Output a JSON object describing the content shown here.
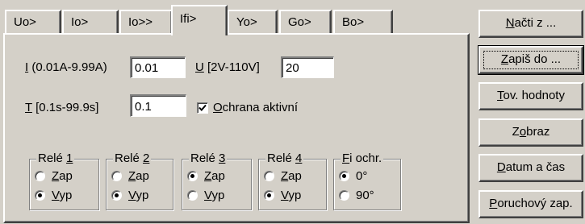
{
  "tabs": [
    {
      "label": "Uo>",
      "active": false
    },
    {
      "label": "Io>",
      "active": false
    },
    {
      "label": "Io>>",
      "active": false
    },
    {
      "label": "Ifi>",
      "active": true
    },
    {
      "label": "Yo>",
      "active": false
    },
    {
      "label": "Go>",
      "active": false
    },
    {
      "label": "Bo>",
      "active": false
    }
  ],
  "fields": {
    "current": {
      "label_key": "I",
      "label_rest": " (0.01A-9.99A)",
      "value": "0.01"
    },
    "voltage": {
      "label_key": "U",
      "label_rest": " [2V-110V]",
      "value": "20"
    },
    "time": {
      "label_key": "T",
      "label_rest": " [0.1s-99.9s]",
      "value": "0.1"
    }
  },
  "protection_checkbox": {
    "label_key": "O",
    "label_rest": "chrana aktivní",
    "checked": true
  },
  "relays": [
    {
      "title_pre": "Relé ",
      "title_key": "1",
      "zap_key": "Z",
      "zap_rest": "ap",
      "vyp_key": "V",
      "vyp_rest": "yp",
      "selected": "vyp"
    },
    {
      "title_pre": "Relé ",
      "title_key": "2",
      "zap_key": "Z",
      "zap_rest": "ap",
      "vyp_key": "V",
      "vyp_rest": "yp",
      "selected": "vyp"
    },
    {
      "title_pre": "Relé ",
      "title_key": "3",
      "zap_key": "Z",
      "zap_rest": "ap",
      "vyp_key": "V",
      "vyp_rest": "yp",
      "selected": "zap"
    },
    {
      "title_pre": "Relé ",
      "title_key": "4",
      "zap_key": "Z",
      "zap_rest": "ap",
      "vyp_key": "V",
      "vyp_rest": "yp",
      "selected": "vyp"
    }
  ],
  "fi_group": {
    "title_key": "F",
    "title_rest": "i ochr.",
    "options": [
      "0°",
      "90°"
    ],
    "selected": "0°"
  },
  "buttons": [
    {
      "pre": "",
      "key": "N",
      "post": "ačti z ...",
      "focused": false
    },
    {
      "pre": "",
      "key": "Z",
      "post": "apiš do ...",
      "focused": true
    },
    {
      "pre": "",
      "key": "T",
      "post": "ov. hodnoty",
      "focused": false
    },
    {
      "pre": "Z",
      "key": "o",
      "post": "braz",
      "focused": false
    },
    {
      "pre": "",
      "key": "D",
      "post": "atum a čas",
      "focused": false
    },
    {
      "pre": "",
      "key": "P",
      "post": "oruchový zap.",
      "focused": false
    }
  ]
}
